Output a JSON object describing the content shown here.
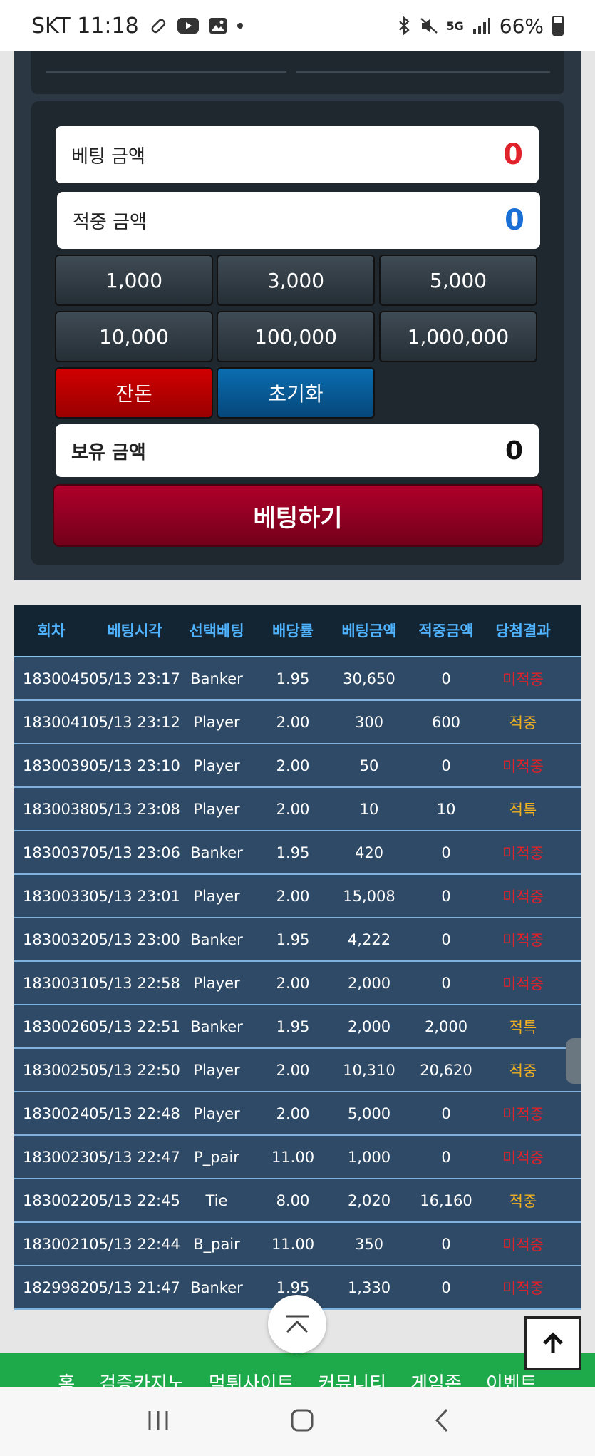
{
  "status_bar": {
    "carrier_time": "SKT 11:18",
    "network": "5G",
    "battery": "66%",
    "icons_left": [
      "bandage-icon",
      "youtube-icon",
      "image-icon",
      "dot-icon"
    ],
    "icons_right": [
      "bluetooth-icon",
      "mute-icon",
      "5g-icon",
      "signal-icon",
      "battery-icon"
    ]
  },
  "betting": {
    "bet_amount_label": "베팅 금액",
    "bet_amount_value": "0",
    "win_amount_label": "적중 금액",
    "win_amount_value": "0",
    "chips": [
      "1,000",
      "3,000",
      "5,000",
      "10,000",
      "100,000",
      "1,000,000"
    ],
    "change_label": "잔돈",
    "reset_label": "초기화",
    "balance_label": "보유 금액",
    "balance_value": "0",
    "submit_label": "베팅하기"
  },
  "history": {
    "headers": [
      "회차",
      "베팅시각",
      "선택베팅",
      "배당률",
      "베팅금액",
      "적중금액",
      "당첨결과"
    ],
    "rows": [
      [
        "1830045",
        "05/13 23:17",
        "Banker",
        "1.95",
        "30,650",
        "0",
        "미적중"
      ],
      [
        "1830041",
        "05/13 23:12",
        "Player",
        "2.00",
        "300",
        "600",
        "적중"
      ],
      [
        "1830039",
        "05/13 23:10",
        "Player",
        "2.00",
        "50",
        "0",
        "미적중"
      ],
      [
        "1830038",
        "05/13 23:08",
        "Player",
        "2.00",
        "10",
        "10",
        "적특"
      ],
      [
        "1830037",
        "05/13 23:06",
        "Banker",
        "1.95",
        "420",
        "0",
        "미적중"
      ],
      [
        "1830033",
        "05/13 23:01",
        "Player",
        "2.00",
        "15,008",
        "0",
        "미적중"
      ],
      [
        "1830032",
        "05/13 23:00",
        "Banker",
        "1.95",
        "4,222",
        "0",
        "미적중"
      ],
      [
        "1830031",
        "05/13 22:58",
        "Player",
        "2.00",
        "2,000",
        "0",
        "미적중"
      ],
      [
        "1830026",
        "05/13 22:51",
        "Banker",
        "1.95",
        "2,000",
        "2,000",
        "적특"
      ],
      [
        "1830025",
        "05/13 22:50",
        "Player",
        "2.00",
        "10,310",
        "20,620",
        "적중"
      ],
      [
        "1830024",
        "05/13 22:48",
        "Player",
        "2.00",
        "5,000",
        "0",
        "미적중"
      ],
      [
        "1830023",
        "05/13 22:47",
        "P_pair",
        "11.00",
        "1,000",
        "0",
        "미적중"
      ],
      [
        "1830022",
        "05/13 22:45",
        "Tie",
        "8.00",
        "2,020",
        "16,160",
        "적중"
      ],
      [
        "1830021",
        "05/13 22:44",
        "B_pair",
        "11.00",
        "350",
        "0",
        "미적중"
      ],
      [
        "1829982",
        "05/13 21:47",
        "Banker",
        "1.95",
        "1,330",
        "0",
        "미적중"
      ]
    ]
  },
  "footer_nav": [
    "홈",
    "검증카지노",
    "먹튀사이트",
    "커뮤니티",
    "게임존",
    "이벤트"
  ],
  "colors": {
    "bet_amount": "#e0222a",
    "win_amount": "#1a6fd6",
    "result_lose": "#e0222a",
    "result_win": "#f0b020",
    "submit": "#a00026",
    "footer": "#1ea94a"
  }
}
